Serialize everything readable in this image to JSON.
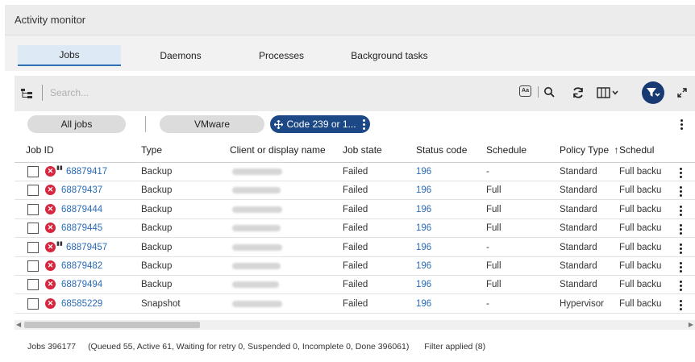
{
  "window": {
    "title": "Activity monitor"
  },
  "tabs": [
    {
      "label": "Jobs",
      "active": true
    },
    {
      "label": "Daemons",
      "active": false
    },
    {
      "label": "Processes",
      "active": false
    },
    {
      "label": "Background tasks",
      "active": false
    }
  ],
  "toolbar": {
    "search_placeholder": "Search...",
    "match_case_label": "Aa"
  },
  "filters": {
    "all_jobs": "All jobs",
    "vmware": "VMware",
    "code_filter": "Code 239 or 1..."
  },
  "table": {
    "columns": [
      "Job ID",
      "Type",
      "Client or display name",
      "Job state",
      "Status code",
      "Schedule",
      "Policy Type",
      "Schedul"
    ],
    "sort_indicator": "↑",
    "rows": [
      {
        "job_id": "68879417",
        "type": "Backup",
        "state": "Failed",
        "status": "196",
        "schedule": "-",
        "policy": "Standard",
        "sched_type": "Full backup",
        "flag": true
      },
      {
        "job_id": "68879437",
        "type": "Backup",
        "state": "Failed",
        "status": "196",
        "schedule": "Full",
        "policy": "Standard",
        "sched_type": "Full backup",
        "flag": false
      },
      {
        "job_id": "68879444",
        "type": "Backup",
        "state": "Failed",
        "status": "196",
        "schedule": "Full",
        "policy": "Standard",
        "sched_type": "Full backup",
        "flag": false
      },
      {
        "job_id": "68879445",
        "type": "Backup",
        "state": "Failed",
        "status": "196",
        "schedule": "Full",
        "policy": "Standard",
        "sched_type": "Full backup",
        "flag": false
      },
      {
        "job_id": "68879457",
        "type": "Backup",
        "state": "Failed",
        "status": "196",
        "schedule": "-",
        "policy": "Standard",
        "sched_type": "Full backup",
        "flag": true
      },
      {
        "job_id": "68879482",
        "type": "Backup",
        "state": "Failed",
        "status": "196",
        "schedule": "Full",
        "policy": "Standard",
        "sched_type": "Full backup",
        "flag": false
      },
      {
        "job_id": "68879494",
        "type": "Backup",
        "state": "Failed",
        "status": "196",
        "schedule": "Full",
        "policy": "Standard",
        "sched_type": "Full backup",
        "flag": false
      },
      {
        "job_id": "68585229",
        "type": "Snapshot",
        "state": "Failed",
        "status": "196",
        "schedule": "-",
        "policy": "Hypervisor",
        "sched_type": "Full backup",
        "flag": false
      }
    ]
  },
  "footer": {
    "jobs_count": "Jobs 396177",
    "breakdown": "(Queued 55, Active 61, Waiting for retry 0, Suspended 0, Incomplete 0, Done 396061)",
    "filter_status": "Filter applied (8)"
  },
  "colors": {
    "accent": "#1c4885",
    "link": "#2a6bb5",
    "error": "#d7263d",
    "filter_button": "#173a72"
  },
  "icons": {
    "tree": "tree-view-icon",
    "search": "search-icon",
    "refresh": "refresh-icon",
    "columns": "columns-icon",
    "filter": "filter-icon",
    "expand": "expand-icon",
    "move": "move-icon",
    "error": "error-icon",
    "more": "more-options-icon"
  }
}
